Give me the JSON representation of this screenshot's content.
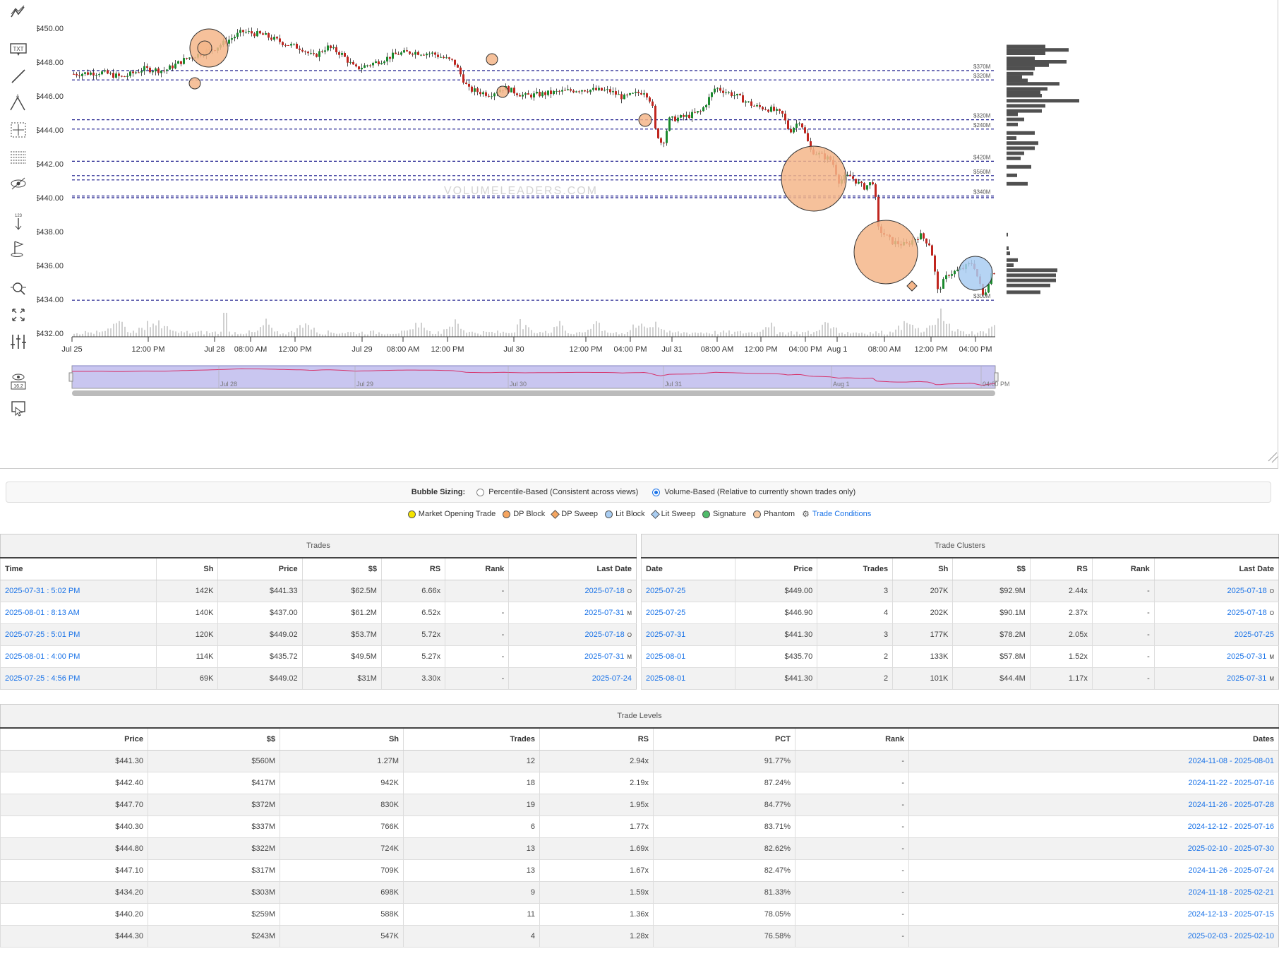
{
  "toolbar": {
    "icons": [
      "trend-icon",
      "text-icon",
      "line-icon",
      "abc-pattern-icon",
      "crosshair-grid-icon",
      "fib-lines-icon",
      "hide-icon",
      "measure-icon",
      "flag-icon",
      "zoom-icon",
      "fit-icon",
      "settings-bars-icon",
      "eye-value-icon",
      "pin-icon"
    ]
  },
  "chart_data": {
    "type": "candlestick",
    "watermark": "VOLUMELEADERS.COM",
    "y_ticks": [
      "$450.00",
      "$448.00",
      "$446.00",
      "$444.00",
      "$442.00",
      "$440.00",
      "$438.00",
      "$436.00",
      "$434.00",
      "$432.00"
    ],
    "ylim": [
      432,
      451.5
    ],
    "x_ticks": [
      "Jul 25",
      "12:00 PM",
      "Jul 28",
      "08:00 AM",
      "12:00 PM",
      "Jul 29",
      "08:00 AM",
      "12:00 PM",
      "Jul 30",
      "12:00 PM",
      "04:00 PM",
      "Jul 31",
      "08:00 AM",
      "12:00 PM",
      "04:00 PM",
      "Aug 1",
      "08:00 AM",
      "12:00 PM",
      "04:00 PM"
    ],
    "levels": [
      {
        "price": 447.5,
        "label": "$370M"
      },
      {
        "price": 446.95,
        "label": "$320M"
      },
      {
        "price": 444.6,
        "label": "$320M"
      },
      {
        "price": 444.05,
        "label": "$240M"
      },
      {
        "price": 442.15,
        "label": "$420M"
      },
      {
        "price": 441.3,
        "label": "$560M"
      },
      {
        "price": 441.05,
        "label": ""
      },
      {
        "price": 440.1,
        "label": "$340M"
      },
      {
        "price": 440.0,
        "label": ""
      },
      {
        "price": 433.95,
        "label": "$300M"
      }
    ],
    "navigator_labels": [
      "Jul 28",
      "Jul 29",
      "Jul 30",
      "Jul 31",
      "Aug 1",
      "04:00 PM"
    ]
  },
  "bubble_sizing": {
    "label": "Bubble Sizing:",
    "options": [
      "Percentile-Based (Consistent across views)",
      "Volume-Based (Relative to currently shown trades only)"
    ],
    "selected": 1
  },
  "legend": {
    "items": [
      {
        "label": "Market Opening Trade",
        "color": "#f5e400",
        "shape": "circle"
      },
      {
        "label": "DP Block",
        "color": "#f5a560",
        "shape": "circle"
      },
      {
        "label": "DP Sweep",
        "color": "#f5a560",
        "shape": "diamond"
      },
      {
        "label": "Lit Block",
        "color": "#a9cdf2",
        "shape": "circle"
      },
      {
        "label": "Lit Sweep",
        "color": "#a9cdf2",
        "shape": "diamond"
      },
      {
        "label": "Signature",
        "color": "#4fbb6a",
        "shape": "circle"
      },
      {
        "label": "Phantom",
        "color": "#f7c9a0",
        "shape": "phantom"
      }
    ],
    "conditions_label": "Trade Conditions"
  },
  "trades": {
    "title": "Trades",
    "columns": [
      "Time",
      "Sh",
      "Price",
      "$$",
      "RS",
      "Rank",
      "Last Date"
    ],
    "rows": [
      {
        "time": "2025-07-31 : 5:02 PM",
        "sh": "142K",
        "price": "$441.33",
        "dollars": "$62.5M",
        "rs": "6.66x",
        "rank": "-",
        "last": "2025-07-18",
        "tag": "O"
      },
      {
        "time": "2025-08-01 : 8:13 AM",
        "sh": "140K",
        "price": "$437.00",
        "dollars": "$61.2M",
        "rs": "6.52x",
        "rank": "-",
        "last": "2025-07-31",
        "tag": "M"
      },
      {
        "time": "2025-07-25 : 5:01 PM",
        "sh": "120K",
        "price": "$449.02",
        "dollars": "$53.7M",
        "rs": "5.72x",
        "rank": "-",
        "last": "2025-07-18",
        "tag": "O"
      },
      {
        "time": "2025-08-01 : 4:00 PM",
        "sh": "114K",
        "price": "$435.72",
        "dollars": "$49.5M",
        "rs": "5.27x",
        "rank": "-",
        "last": "2025-07-31",
        "tag": "M"
      },
      {
        "time": "2025-07-25 : 4:56 PM",
        "sh": "69K",
        "price": "$449.02",
        "dollars": "$31M",
        "rs": "3.30x",
        "rank": "-",
        "last": "2025-07-24",
        "tag": ""
      }
    ]
  },
  "clusters": {
    "title": "Trade Clusters",
    "columns": [
      "Date",
      "Price",
      "Trades",
      "Sh",
      "$$",
      "RS",
      "Rank",
      "Last Date"
    ],
    "rows": [
      {
        "date": "2025-07-25",
        "price": "$449.00",
        "trades": "3",
        "sh": "207K",
        "dollars": "$92.9M",
        "rs": "2.44x",
        "rank": "-",
        "last": "2025-07-18",
        "tag": "O"
      },
      {
        "date": "2025-07-25",
        "price": "$446.90",
        "trades": "4",
        "sh": "202K",
        "dollars": "$90.1M",
        "rs": "2.37x",
        "rank": "-",
        "last": "2025-07-18",
        "tag": "O"
      },
      {
        "date": "2025-07-31",
        "price": "$441.30",
        "trades": "3",
        "sh": "177K",
        "dollars": "$78.2M",
        "rs": "2.05x",
        "rank": "-",
        "last": "2025-07-25",
        "tag": ""
      },
      {
        "date": "2025-08-01",
        "price": "$435.70",
        "trades": "2",
        "sh": "133K",
        "dollars": "$57.8M",
        "rs": "1.52x",
        "rank": "-",
        "last": "2025-07-31",
        "tag": "M"
      },
      {
        "date": "2025-08-01",
        "price": "$441.30",
        "trades": "2",
        "sh": "101K",
        "dollars": "$44.4M",
        "rs": "1.17x",
        "rank": "-",
        "last": "2025-07-31",
        "tag": "M"
      }
    ]
  },
  "levels_table": {
    "title": "Trade Levels",
    "columns": [
      "Price",
      "$$",
      "Sh",
      "Trades",
      "RS",
      "PCT",
      "Rank",
      "Dates"
    ],
    "rows": [
      {
        "price": "$441.30",
        "dollars": "$560M",
        "sh": "1.27M",
        "trades": "12",
        "rs": "2.94x",
        "pct": "91.77%",
        "rank": "-",
        "dates": "2024-11-08 - 2025-08-01"
      },
      {
        "price": "$442.40",
        "dollars": "$417M",
        "sh": "942K",
        "trades": "18",
        "rs": "2.19x",
        "pct": "87.24%",
        "rank": "-",
        "dates": "2024-11-22 - 2025-07-16"
      },
      {
        "price": "$447.70",
        "dollars": "$372M",
        "sh": "830K",
        "trades": "19",
        "rs": "1.95x",
        "pct": "84.77%",
        "rank": "-",
        "dates": "2024-11-26 - 2025-07-28"
      },
      {
        "price": "$440.30",
        "dollars": "$337M",
        "sh": "766K",
        "trades": "6",
        "rs": "1.77x",
        "pct": "83.71%",
        "rank": "-",
        "dates": "2024-12-12 - 2025-07-16"
      },
      {
        "price": "$444.80",
        "dollars": "$322M",
        "sh": "724K",
        "trades": "13",
        "rs": "1.69x",
        "pct": "82.62%",
        "rank": "-",
        "dates": "2025-02-10 - 2025-07-30"
      },
      {
        "price": "$447.10",
        "dollars": "$317M",
        "sh": "709K",
        "trades": "13",
        "rs": "1.67x",
        "pct": "82.47%",
        "rank": "-",
        "dates": "2024-11-26 - 2025-07-24"
      },
      {
        "price": "$434.20",
        "dollars": "$303M",
        "sh": "698K",
        "trades": "9",
        "rs": "1.59x",
        "pct": "81.33%",
        "rank": "-",
        "dates": "2024-11-18 - 2025-02-21"
      },
      {
        "price": "$440.20",
        "dollars": "$259M",
        "sh": "588K",
        "trades": "11",
        "rs": "1.36x",
        "pct": "78.05%",
        "rank": "-",
        "dates": "2024-12-13 - 2025-07-15"
      },
      {
        "price": "$444.30",
        "dollars": "$243M",
        "sh": "547K",
        "trades": "4",
        "rs": "1.28x",
        "pct": "76.58%",
        "rank": "-",
        "dates": "2025-02-03 - 2025-02-10"
      }
    ]
  }
}
